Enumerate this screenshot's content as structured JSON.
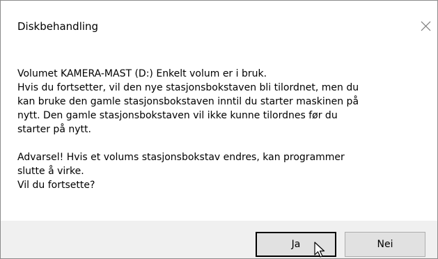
{
  "dialog": {
    "title": "Diskbehandling",
    "close_icon": "close-icon",
    "message": {
      "lines_p1": [
        "Volumet KAMERA-MAST (D:) Enkelt volum er i bruk.",
        "Hvis du fortsetter, vil den nye stasjonsbokstaven bli tilordnet, men du",
        "kan bruke den gamle stasjonsbokstaven inntil du starter maskinen på",
        "nytt. Den gamle stasjonsbokstaven vil ikke kunne tilordnes før du",
        "starter på nytt."
      ],
      "lines_p2": [
        "Advarsel!  Hvis et volums stasjonsbokstav endres, kan programmer",
        "slutte å virke.",
        "Vil du fortsette?"
      ]
    },
    "buttons": {
      "yes_label": "Ja",
      "no_label": "Nei"
    }
  },
  "colors": {
    "footer_bg": "#f0f0f0",
    "button_bg": "#e1e1e1",
    "default_button_border": "#000000"
  },
  "pointer": "mouse-pointer-icon"
}
